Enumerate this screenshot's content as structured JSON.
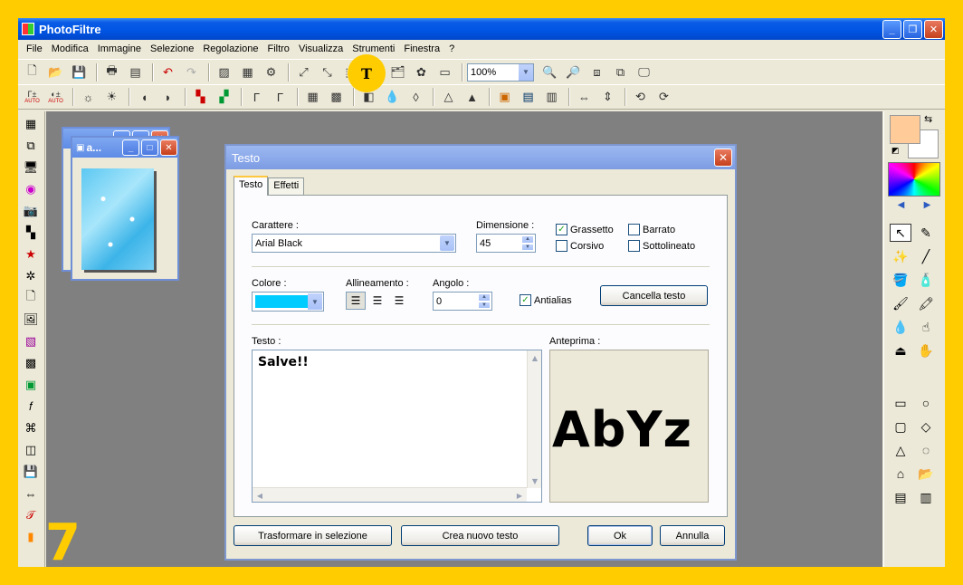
{
  "app": {
    "title": "PhotoFiltre"
  },
  "menu": [
    "File",
    "Modifica",
    "Immagine",
    "Selezione",
    "Regolazione",
    "Filtro",
    "Visualizza",
    "Strumenti",
    "Finestra",
    "?"
  ],
  "toolbar": {
    "zoom_value": "100%",
    "text_tool_glyph": "T"
  },
  "toolbar2": {
    "auto_label": "AUTO"
  },
  "image_window": {
    "title": "a..."
  },
  "dialog": {
    "title": "Testo",
    "tabs": [
      {
        "label": "Testo"
      },
      {
        "label": "Effetti"
      }
    ],
    "font_label": "Carattere :",
    "font_value": "Arial Black",
    "size_label": "Dimensione :",
    "size_value": "45",
    "bold": {
      "label": "Grassetto",
      "checked": true
    },
    "strike": {
      "label": "Barrato",
      "checked": false
    },
    "italic": {
      "label": "Corsivo",
      "checked": false
    },
    "underline": {
      "label": "Sottolineato",
      "checked": false
    },
    "color_label": "Colore :",
    "color_value": "#00CCFF",
    "align_label": "Allineamento :",
    "angle_label": "Angolo :",
    "angle_value": "0",
    "antialias": {
      "label": "Antialias",
      "checked": true
    },
    "clear_text_button": "Cancella testo",
    "text_label": "Testo :",
    "text_value": "Salve!!",
    "preview_label": "Anteprima :",
    "preview_text": "AbYz",
    "transform_button": "Trasformare in selezione",
    "new_text_button": "Crea nuovo testo",
    "ok_button": "Ok",
    "cancel_button": "Annulla"
  },
  "tutorial": {
    "step_number": "7"
  },
  "colors": {
    "highlight": "#FFCC00",
    "foreground": "#FFCC99",
    "background": "#FFFFFF",
    "text_color": "#00CCFF"
  }
}
